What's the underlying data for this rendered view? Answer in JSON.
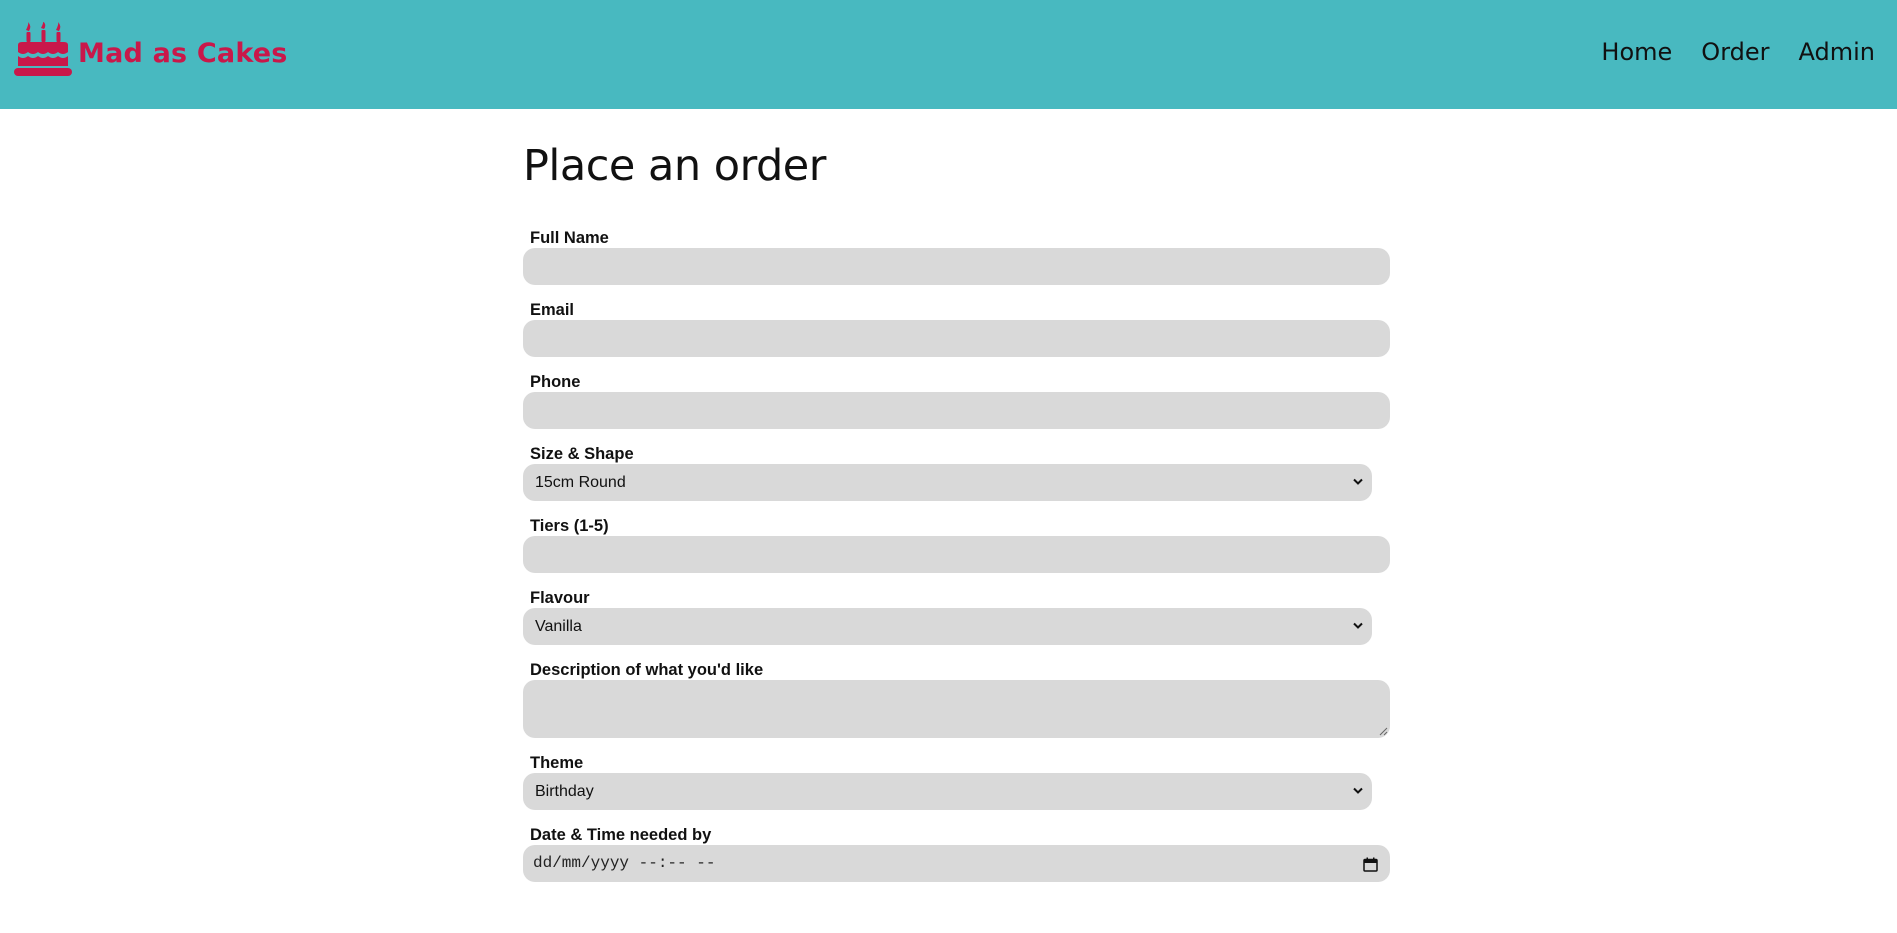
{
  "header": {
    "brand_name": "Mad as Cakes",
    "brand_icon": "cake-icon",
    "nav": [
      {
        "label": "Home"
      },
      {
        "label": "Order"
      },
      {
        "label": "Admin"
      }
    ]
  },
  "colors": {
    "header_bg": "#48b9c0",
    "brand": "#c9184a",
    "field_bg": "#d9d9d9"
  },
  "main": {
    "title": "Place an order",
    "fields": {
      "full_name": {
        "label": "Full Name",
        "value": ""
      },
      "email": {
        "label": "Email",
        "value": ""
      },
      "phone": {
        "label": "Phone",
        "value": ""
      },
      "size_shape": {
        "label": "Size & Shape",
        "selected": "15cm Round"
      },
      "tiers": {
        "label": "Tiers (1-5)",
        "value": ""
      },
      "flavour": {
        "label": "Flavour",
        "selected": "Vanilla"
      },
      "description": {
        "label": "Description of what you'd like",
        "value": ""
      },
      "theme": {
        "label": "Theme",
        "selected": "Birthday"
      },
      "datetime": {
        "label": "Date & Time needed by",
        "placeholder": "dd/mm/yyyy --:-- --"
      }
    }
  }
}
